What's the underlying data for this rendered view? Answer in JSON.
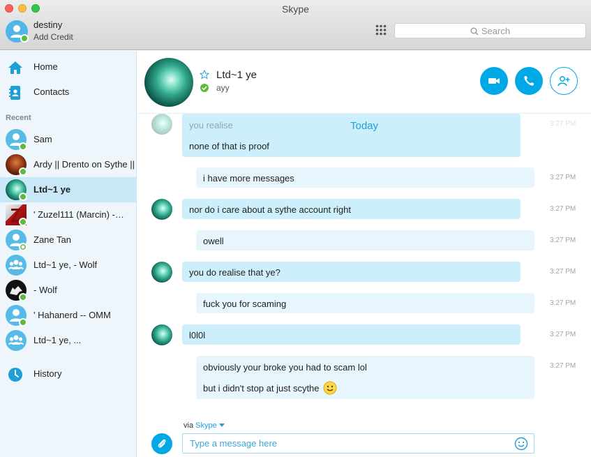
{
  "window": {
    "title": "Skype"
  },
  "profile": {
    "name": "destiny",
    "credit_link": "Add Credit"
  },
  "search": {
    "placeholder": "Search"
  },
  "nav": [
    {
      "label": "Home",
      "icon": "home-icon"
    },
    {
      "label": "Contacts",
      "icon": "contacts-book-icon"
    }
  ],
  "recent": {
    "title": "Recent",
    "contacts": [
      {
        "name": "Sam",
        "status": "online",
        "avatar": "default-user"
      },
      {
        "name": "Ardy || Drento on Sythe ||",
        "status": "online",
        "avatar": "photo"
      },
      {
        "name": "Ltd~1 ye",
        "status": "online",
        "avatar": "photo",
        "active": true
      },
      {
        "name": "' Zuzel111 (Marcin) -…",
        "status": "online",
        "avatar": "photo"
      },
      {
        "name": "Zane Tan",
        "status": "away",
        "avatar": "default-user"
      },
      {
        "name": "Ltd~1 ye, - Wolf",
        "status": "group",
        "avatar": "group"
      },
      {
        "name": "- Wolf",
        "status": "online",
        "avatar": "photo"
      },
      {
        "name": "' Hahanerd -- OMM",
        "status": "online",
        "avatar": "default-user"
      },
      {
        "name": "Ltd~1 ye, ...",
        "status": "group",
        "avatar": "group"
      }
    ]
  },
  "history": {
    "label": "History"
  },
  "chat": {
    "name": "Ltd~1 ye",
    "mood": "ayy",
    "today_label": "Today",
    "messages": [
      {
        "side": "in",
        "lines": [
          "you realise",
          "none of that is proof"
        ],
        "time": "3:27 PM"
      },
      {
        "side": "out",
        "lines": [
          "i have more messages"
        ],
        "time": "3:27 PM"
      },
      {
        "side": "in",
        "lines": [
          "nor do i care about a sythe account right"
        ],
        "time": "3:27 PM"
      },
      {
        "side": "out",
        "lines": [
          "owell"
        ],
        "time": "3:27 PM"
      },
      {
        "side": "in",
        "lines": [
          "you do realise that ye?"
        ],
        "time": "3:27 PM"
      },
      {
        "side": "out",
        "lines": [
          "fuck you for scaming"
        ],
        "time": "3:27 PM"
      },
      {
        "side": "in",
        "lines": [
          "l0l0l"
        ],
        "time": "3:27 PM"
      },
      {
        "side": "out",
        "lines": [
          "obviously your broke you had to scam lol",
          "but i didn't stop at just scythe"
        ],
        "time": "3:27 PM"
      }
    ]
  },
  "compose": {
    "via_prefix": "via",
    "via_brand": "Skype",
    "placeholder": "Type a message here"
  },
  "colors": {
    "accent": "#00a9e6",
    "online": "#5fb93f",
    "bubble_in": "#cdeefb",
    "bubble_out": "#e7f5fc"
  }
}
